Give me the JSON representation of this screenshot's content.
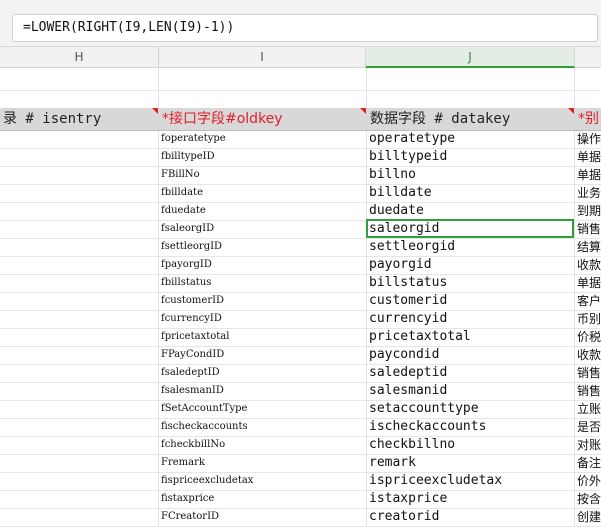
{
  "formula": "=LOWER(RIGHT(I9,LEN(I9)-1))",
  "columns": {
    "h": "H",
    "i": "I",
    "j": "J"
  },
  "header_row": {
    "h": "录 # isentry",
    "i": "*接口字段#oldkey",
    "j": "数据字段 # datakey",
    "k": "*别"
  },
  "rows": [
    {
      "i": "foperatetype",
      "j": "operatetype",
      "k": "操作"
    },
    {
      "i": "fbilltypeID",
      "j": "billtypeid",
      "k": "单据"
    },
    {
      "i": "FBillNo",
      "j": "billno",
      "k": "单据"
    },
    {
      "i": "fbilldate",
      "j": "billdate",
      "k": "业务"
    },
    {
      "i": "fduedate",
      "j": "duedate",
      "k": "到期"
    },
    {
      "i": "fsaleorgID",
      "j": "saleorgid",
      "k": "销售"
    },
    {
      "i": "fsettleorgID",
      "j": "settleorgid",
      "k": "结算"
    },
    {
      "i": "fpayorgID",
      "j": "payorgid",
      "k": "收款"
    },
    {
      "i": "fbillstatus",
      "j": "billstatus",
      "k": "单据"
    },
    {
      "i": "fcustomerID",
      "j": "customerid",
      "k": "客户"
    },
    {
      "i": "fcurrencyID",
      "j": "currencyid",
      "k": "币别"
    },
    {
      "i": "fpricetaxtotal",
      "j": "pricetaxtotal",
      "k": "价税"
    },
    {
      "i": "FPayCondID",
      "j": "paycondid",
      "k": "收款"
    },
    {
      "i": "fsaledeptID",
      "j": "saledeptid",
      "k": "销售"
    },
    {
      "i": "fsalesmanID",
      "j": "salesmanid",
      "k": "销售"
    },
    {
      "i": "fSetAccountType",
      "j": "setaccounttype",
      "k": "立账"
    },
    {
      "i": "fischeckaccounts",
      "j": "ischeckaccounts",
      "k": "是否"
    },
    {
      "i": "fcheckbillNo",
      "j": "checkbillno",
      "k": "对账"
    },
    {
      "i": "Fremark",
      "j": "remark",
      "k": "备注"
    },
    {
      "i": "fispriceexcludetax",
      "j": "ispriceexcludetax",
      "k": "价外"
    },
    {
      "i": "fistaxprice",
      "j": "istaxprice",
      "k": "按含"
    },
    {
      "i": "FCreatorID",
      "j": "creatorid",
      "k": "创建"
    }
  ]
}
